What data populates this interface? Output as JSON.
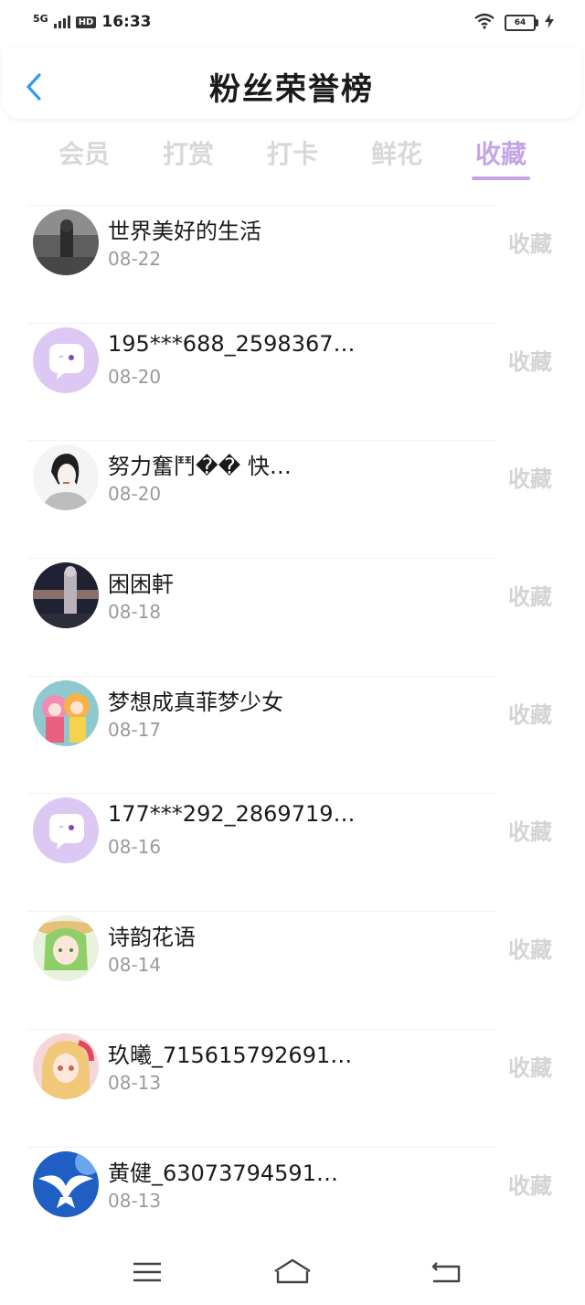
{
  "status": {
    "network": "5G",
    "hd": "HD",
    "time": "16:33",
    "battery": "64"
  },
  "header": {
    "title": "粉丝荣誉榜"
  },
  "tabs": [
    {
      "label": "会员",
      "active": false
    },
    {
      "label": "打赏",
      "active": false
    },
    {
      "label": "打卡",
      "active": false
    },
    {
      "label": "鲜花",
      "active": false
    },
    {
      "label": "收藏",
      "active": true
    }
  ],
  "fans": [
    {
      "name": "世界美好的生活",
      "date": "08-22",
      "action": "收藏",
      "avatar": "photo-dark"
    },
    {
      "name": "195***688_2598367…",
      "date": "08-20",
      "action": "收藏",
      "avatar": "default-chat"
    },
    {
      "name": "努力奮鬥�� 快…",
      "date": "08-20",
      "action": "收藏",
      "avatar": "sketch-girl"
    },
    {
      "name": "困困軒",
      "date": "08-18",
      "action": "收藏",
      "avatar": "photo-night"
    },
    {
      "name": "梦想成真菲梦少女",
      "date": "08-17",
      "action": "收藏",
      "avatar": "cartoon-colorful"
    },
    {
      "name": "177***292_2869719…",
      "date": "08-16",
      "action": "收藏",
      "avatar": "default-chat"
    },
    {
      "name": "诗韵花语",
      "date": "08-14",
      "action": "收藏",
      "avatar": "anime-green"
    },
    {
      "name": "玖曦_715615792691…",
      "date": "08-13",
      "action": "收藏",
      "avatar": "anime-blonde"
    },
    {
      "name": "黄健_63073794591…",
      "date": "08-13",
      "action": "收藏",
      "avatar": "dove-blue"
    }
  ],
  "colors": {
    "accent": "#c4a6e6",
    "back_arrow": "#2b9cf0",
    "inactive_tab": "#d8d8d8",
    "date": "#9a9a9a"
  }
}
